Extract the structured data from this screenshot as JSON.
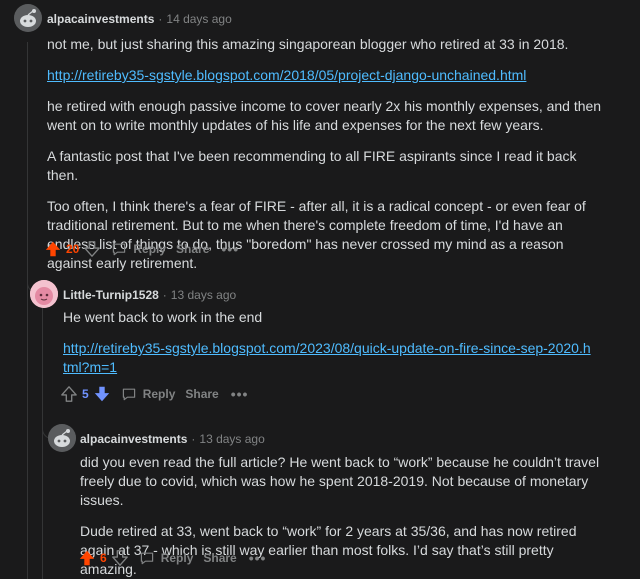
{
  "comments": [
    {
      "user": "alpacainvestments",
      "time": "14 days ago",
      "paragraphs": [
        "not me, but just sharing this amazing singaporean blogger who retired at 33 in 2018.",
        "http://retireby35-sgstyle.blogspot.com/2018/05/project-django-unchained.html",
        "he retired with enough passive income to cover nearly 2x his monthly expenses, and then went on to write monthly updates of his life and expenses for the next few years.",
        "A fantastic post that I've been recommending to all FIRE aspirants since I read it back then.",
        "Too often, I think there's a fear of FIRE - after all, it is a radical concept - or even fear of traditional retirement. But to me when there's complete freedom of time, I'd have an endless list of things to do, thus \"boredom\" has never crossed my mind as a reason against early retirement."
      ],
      "score": "20",
      "vote": "up"
    },
    {
      "user": "Little-Turnip1528",
      "time": "13 days ago",
      "paragraphs": [
        "He went back to work in the end",
        "http://retireby35-sgstyle.blogspot.com/2023/08/quick-update-on-fire-since-sep-2020.html?m=1"
      ],
      "score": "5",
      "vote": "down"
    },
    {
      "user": "alpacainvestments",
      "time": "13 days ago",
      "paragraphs": [
        "did you even read the full article? He went back to “work” because he couldn’t travel freely due to covid, which was how he spent 2018-2019. Not because of monetary issues.",
        "Dude retired at 33, went back to “work” for 2 years at 35/36, and has now retired again at 37 - which is still way earlier than most folks. I’d say that’s still pretty amazing."
      ],
      "score": "6",
      "vote": "up"
    }
  ],
  "actions": {
    "reply": "Reply",
    "share": "Share",
    "more": "•••"
  },
  "colors": {
    "upvote": "#ff4500",
    "downvote": "#7193ff",
    "link": "#4fbcff",
    "muted": "#818384"
  }
}
